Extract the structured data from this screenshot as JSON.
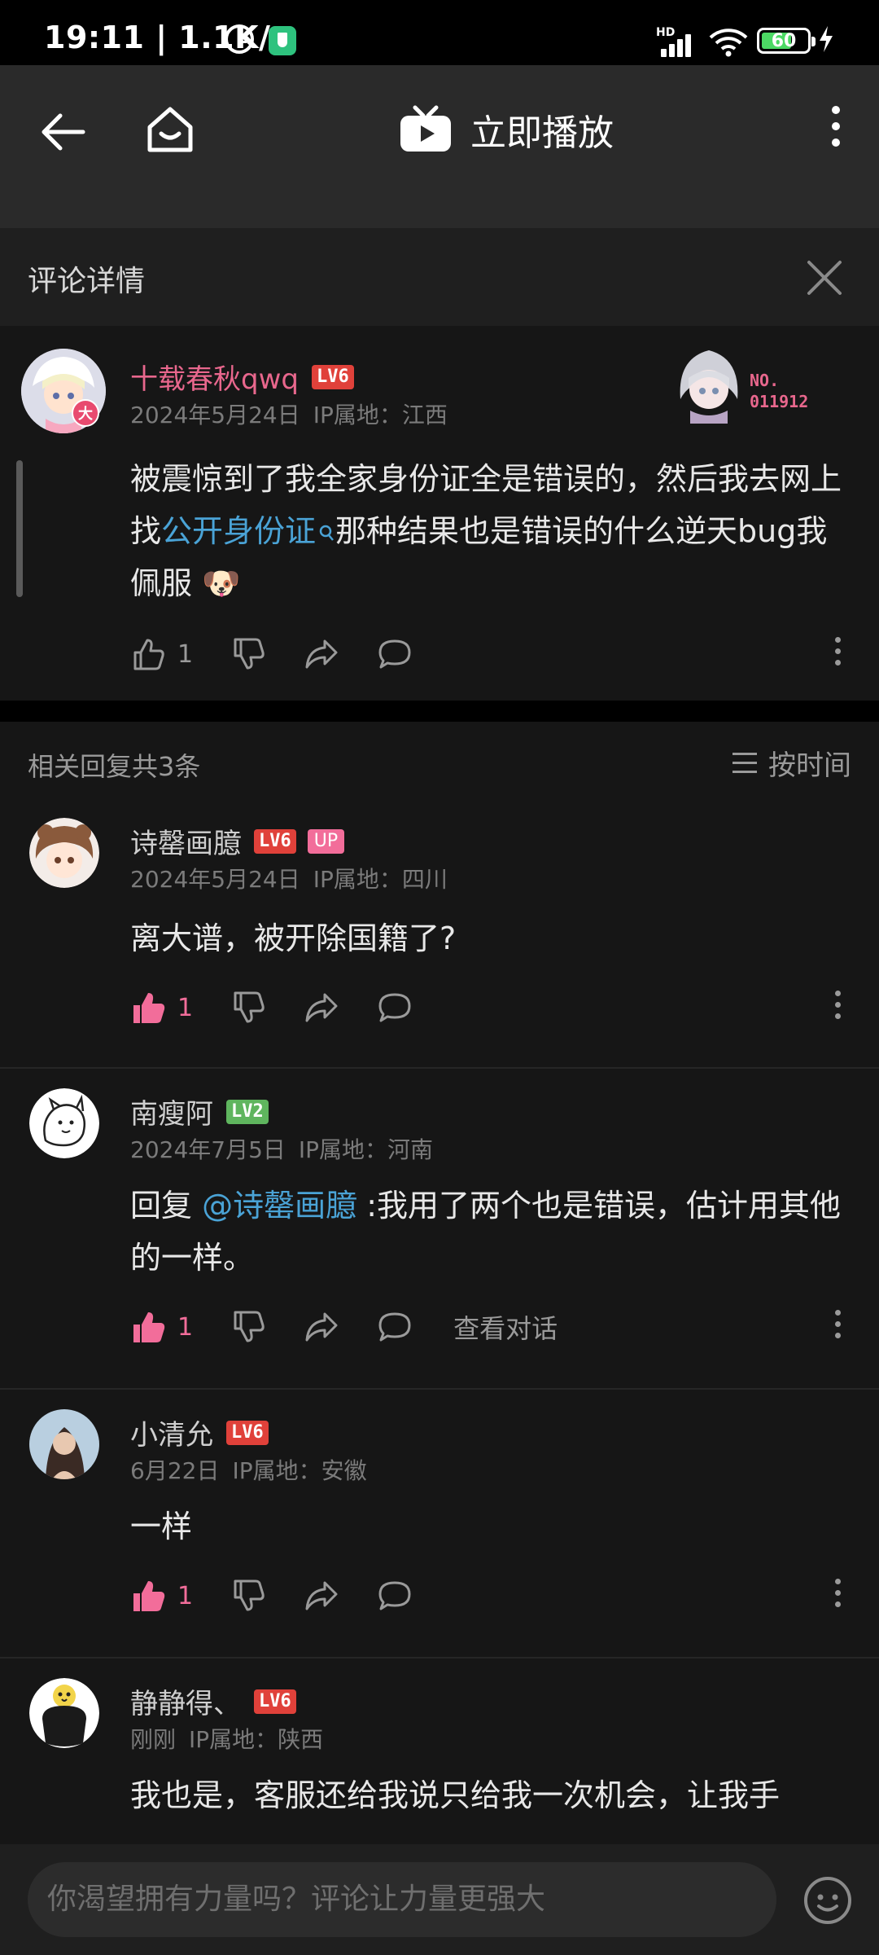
{
  "status_bar": {
    "time": "19:11 | 1.1K/s",
    "network_label": "HD",
    "battery": "60",
    "icons": [
      "alarm-icon",
      "shield-app-icon",
      "signal-icon",
      "wifi-icon",
      "battery-icon",
      "charging-icon"
    ]
  },
  "nav": {
    "play_label": "立即播放",
    "icons": [
      "back-arrow-icon",
      "home-icon",
      "tv-play-icon",
      "more-vertical-icon"
    ]
  },
  "detail": {
    "title": "评论详情"
  },
  "main_comment": {
    "username": "十载春秋qwq",
    "level": "LV6",
    "date": "2024年5月24日",
    "ip": "IP属地：江西",
    "text_part1": "被震惊到了我全家身份证全是错误的，然后我去网上找",
    "link_text": "公开身份证",
    "text_part2": "那种结果也是错误的什么逆天bug我佩服",
    "emoji": "🐶",
    "like_count": "1",
    "fan_badge_line1": "NO.",
    "fan_badge_line2": "011912",
    "avatar_badge": "大"
  },
  "replies_header": {
    "count_label": "相关回复共3条",
    "sort_label": "按时间"
  },
  "replies": [
    {
      "username": "诗罄画臆",
      "level": "LV6",
      "up_badge": "UP",
      "date": "2024年5月24日",
      "ip": "IP属地：四川",
      "text": "离大谱，被开除国籍了?",
      "like_count": "1"
    },
    {
      "username": "南瘦阿",
      "level": "LV2",
      "date": "2024年7月5日",
      "ip": "IP属地：河南",
      "text_prefix": "回复 ",
      "mention": "@诗罄画臆",
      "text": " :我用了两个也是错误，估计用其他的一样。",
      "like_count": "1",
      "view_conversation": "查看对话"
    },
    {
      "username": "小清允",
      "level": "LV6",
      "date": "6月22日",
      "ip": "IP属地：安徽",
      "text": "一样",
      "like_count": "1"
    },
    {
      "username": "静静得、",
      "level": "LV6",
      "date": "刚刚",
      "ip": "IP属地：陕西",
      "text": "我也是，客服还给我说只给我一次机会，让我手"
    }
  ],
  "input": {
    "placeholder": "你渴望拥有力量吗？评论让力量更强大"
  },
  "colors": {
    "accent_pink": "#f26d9a",
    "link_blue": "#4aa3d6",
    "level6_red": "#e0413a",
    "level2_green": "#5fb55e"
  }
}
